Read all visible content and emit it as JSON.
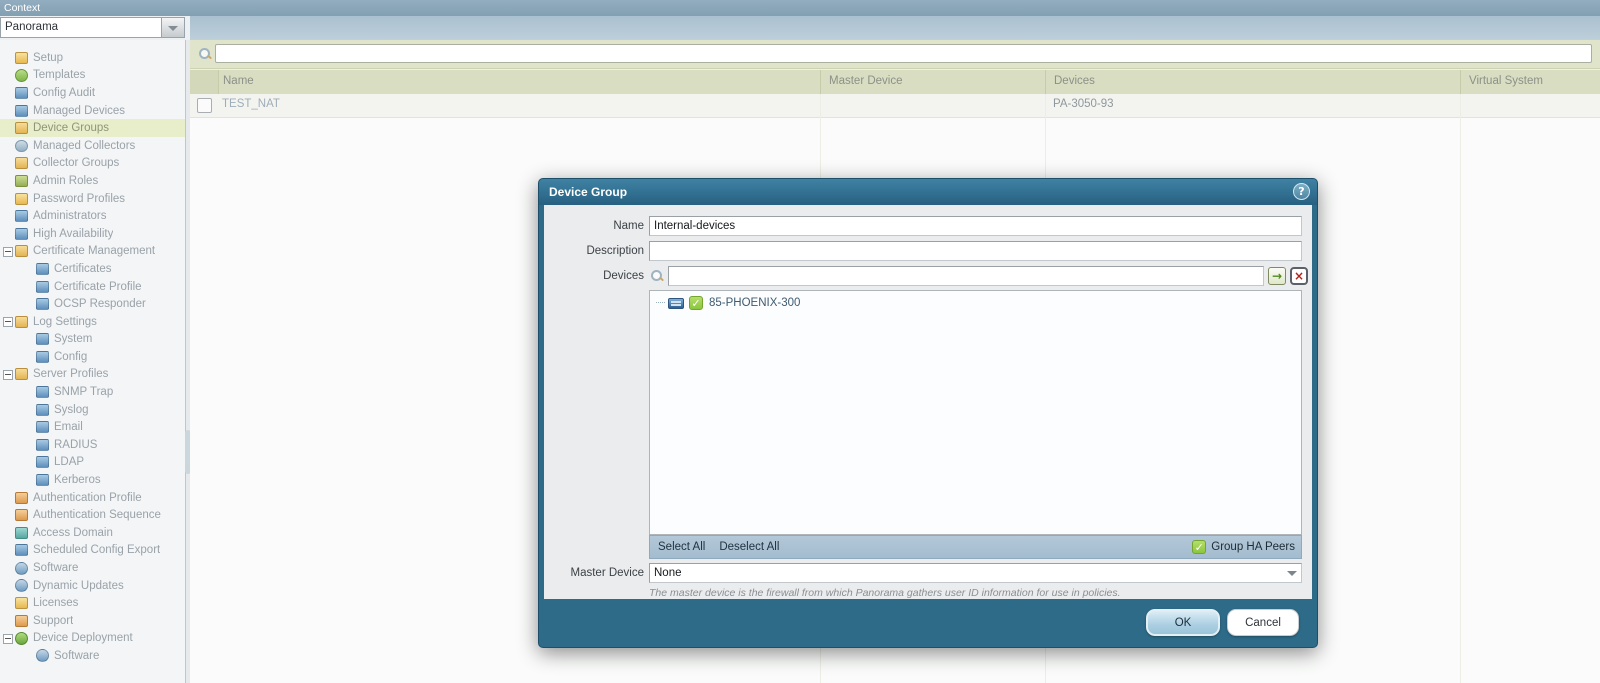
{
  "context_bar": {
    "label": "Context"
  },
  "context_select": {
    "value": "Panorama"
  },
  "sidebar": {
    "items": [
      {
        "id": "setup",
        "label": "Setup",
        "icon": "setup-icon",
        "level": 0
      },
      {
        "id": "templates",
        "label": "Templates",
        "icon": "templates-icon",
        "level": 0
      },
      {
        "id": "config-audit",
        "label": "Config Audit",
        "icon": "config-audit-icon",
        "level": 0
      },
      {
        "id": "managed-devices",
        "label": "Managed Devices",
        "icon": "managed-devices-icon",
        "level": 0
      },
      {
        "id": "device-groups",
        "label": "Device Groups",
        "icon": "device-groups-icon",
        "level": 0,
        "selected": true
      },
      {
        "id": "managed-collectors",
        "label": "Managed Collectors",
        "icon": "managed-collectors-icon",
        "level": 0
      },
      {
        "id": "collector-groups",
        "label": "Collector Groups",
        "icon": "collector-groups-icon",
        "level": 0
      },
      {
        "id": "admin-roles",
        "label": "Admin Roles",
        "icon": "admin-roles-icon",
        "level": 0
      },
      {
        "id": "password-profiles",
        "label": "Password Profiles",
        "icon": "password-profiles-icon",
        "level": 0
      },
      {
        "id": "administrators",
        "label": "Administrators",
        "icon": "administrators-icon",
        "level": 0
      },
      {
        "id": "high-availability",
        "label": "High Availability",
        "icon": "high-availability-icon",
        "level": 0
      },
      {
        "id": "certificate-management",
        "label": "Certificate Management",
        "icon": "certificate-management-icon",
        "level": 0,
        "expandable": true
      },
      {
        "id": "certificates",
        "label": "Certificates",
        "icon": "certificates-icon",
        "level": 1
      },
      {
        "id": "certificate-profile",
        "label": "Certificate Profile",
        "icon": "certificate-profile-icon",
        "level": 1
      },
      {
        "id": "ocsp-responder",
        "label": "OCSP Responder",
        "icon": "ocsp-responder-icon",
        "level": 1
      },
      {
        "id": "log-settings",
        "label": "Log Settings",
        "icon": "log-settings-icon",
        "level": 0,
        "expandable": true
      },
      {
        "id": "system",
        "label": "System",
        "icon": "system-icon",
        "level": 1
      },
      {
        "id": "config",
        "label": "Config",
        "icon": "config-icon",
        "level": 1
      },
      {
        "id": "server-profiles",
        "label": "Server Profiles",
        "icon": "server-profiles-icon",
        "level": 0,
        "expandable": true
      },
      {
        "id": "snmp-trap",
        "label": "SNMP Trap",
        "icon": "snmp-trap-icon",
        "level": 1
      },
      {
        "id": "syslog",
        "label": "Syslog",
        "icon": "syslog-icon",
        "level": 1
      },
      {
        "id": "email",
        "label": "Email",
        "icon": "email-icon",
        "level": 1
      },
      {
        "id": "radius",
        "label": "RADIUS",
        "icon": "radius-icon",
        "level": 1
      },
      {
        "id": "ldap",
        "label": "LDAP",
        "icon": "ldap-icon",
        "level": 1
      },
      {
        "id": "kerberos",
        "label": "Kerberos",
        "icon": "kerberos-icon",
        "level": 1
      },
      {
        "id": "authentication-profile",
        "label": "Authentication Profile",
        "icon": "authentication-profile-icon",
        "level": 0
      },
      {
        "id": "authentication-sequence",
        "label": "Authentication Sequence",
        "icon": "authentication-sequence-icon",
        "level": 0
      },
      {
        "id": "access-domain",
        "label": "Access Domain",
        "icon": "access-domain-icon",
        "level": 0
      },
      {
        "id": "scheduled-config-export",
        "label": "Scheduled Config Export",
        "icon": "scheduled-config-export-icon",
        "level": 0
      },
      {
        "id": "software",
        "label": "Software",
        "icon": "software-icon",
        "level": 0
      },
      {
        "id": "dynamic-updates",
        "label": "Dynamic Updates",
        "icon": "dynamic-updates-icon",
        "level": 0
      },
      {
        "id": "licenses",
        "label": "Licenses",
        "icon": "licenses-icon",
        "level": 0
      },
      {
        "id": "support",
        "label": "Support",
        "icon": "support-icon",
        "level": 0
      },
      {
        "id": "device-deployment",
        "label": "Device Deployment",
        "icon": "device-deployment-icon",
        "level": 0,
        "expandable": true
      },
      {
        "id": "software-deploy",
        "label": "Software",
        "icon": "software-icon",
        "level": 1
      }
    ]
  },
  "toolbar": {
    "filter_value": ""
  },
  "table": {
    "columns": [
      "Name",
      "Master Device",
      "Devices",
      "Virtual System"
    ],
    "rows": [
      {
        "name": "TEST_NAT",
        "master_device": "",
        "devices": "PA-3050-93",
        "virtual_system": ""
      }
    ]
  },
  "dialog": {
    "title": "Device Group",
    "fields": {
      "name_label": "Name",
      "name_value": "Internal-devices",
      "description_label": "Description",
      "description_value": "",
      "devices_label": "Devices",
      "devices_filter_value": ""
    },
    "device_tree": {
      "items": [
        {
          "label": "85-PHOENIX-300",
          "checked": true
        }
      ]
    },
    "list_footer": {
      "select_all": "Select All",
      "deselect_all": "Deselect All",
      "group_ha_peers": "Group HA Peers",
      "group_ha_checked": true
    },
    "master_device_label": "Master Device",
    "master_device_value": "None",
    "master_device_help": "The master device is the firewall from which Panorama gathers user ID information for use in policies.",
    "ok_label": "OK",
    "cancel_label": "Cancel"
  },
  "icons": {
    "search": "magnifier",
    "help": "?",
    "apply_filter": "→",
    "clear_filter": "×",
    "checkbox_checked": "✓",
    "dropdown": "▼",
    "firewall": "device-box"
  },
  "colors": {
    "accent_teal": "#2e6b88",
    "selected_item_bg": "#e8edca",
    "header_green": "#d9ddc1",
    "checkbox_green": "#8bc63e",
    "list_footer_blue": "#a9bfd0"
  }
}
